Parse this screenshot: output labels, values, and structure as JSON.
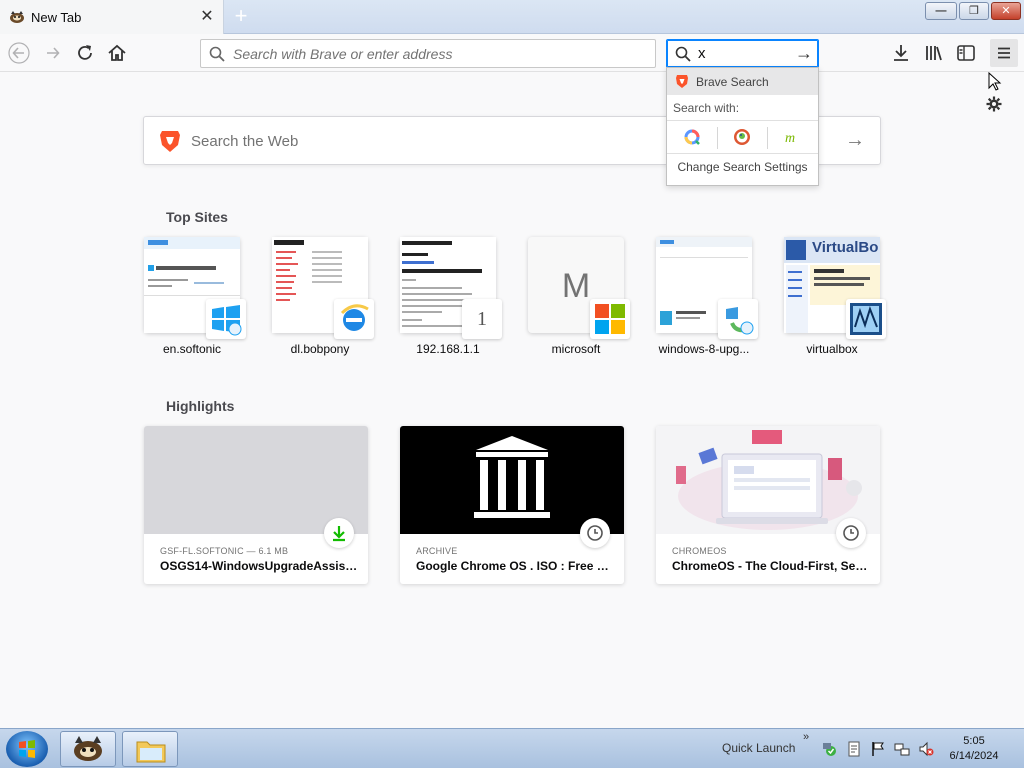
{
  "window": {
    "tab_title": "New Tab",
    "tab_close": "✕",
    "new_tab": "+",
    "minimize": "—",
    "maximize": "❐",
    "close": "✕"
  },
  "toolbar": {
    "url_placeholder": "Search with Brave or enter address",
    "search_value": "x",
    "search_go": "→"
  },
  "search_popup": {
    "engine_label": "Brave Search",
    "search_with_label": "Search with:",
    "engines": [
      "qwant-icon",
      "duckduckgo-icon",
      "mojeek-icon"
    ],
    "settings_label": "Change Search Settings"
  },
  "newtab": {
    "search_placeholder": "Search the Web",
    "search_arrow": "→",
    "top_sites_title": "Top Sites",
    "top_sites": [
      {
        "label": "en.softonic"
      },
      {
        "label": "dl.bobpony"
      },
      {
        "label": "192.168.1.1",
        "badge_text": "1"
      },
      {
        "label": "microsoft",
        "letter": "M"
      },
      {
        "label": "windows-8-upg..."
      },
      {
        "label": "virtualbox",
        "thumb_text": "VirtualBo"
      }
    ],
    "highlights_title": "Highlights",
    "highlights": [
      {
        "context": "GSF-FL.SOFTONIC — 6.1 MB",
        "title": "OSGS14-WindowsUpgradeAssist..."
      },
      {
        "context": "ARCHIVE",
        "title": "Google Chrome OS . ISO : Free D..."
      },
      {
        "context": "CHROMEOS",
        "title": "ChromeOS - The Cloud-First, Sec..."
      }
    ]
  },
  "taskbar": {
    "quick_launch": "Quick Launch",
    "chevron": "»",
    "time": "5:05",
    "date": "6/14/2024"
  },
  "colors": {
    "accent": "#0a84ff",
    "brave": "#fb542b",
    "page_bg": "#f9f9fa"
  }
}
